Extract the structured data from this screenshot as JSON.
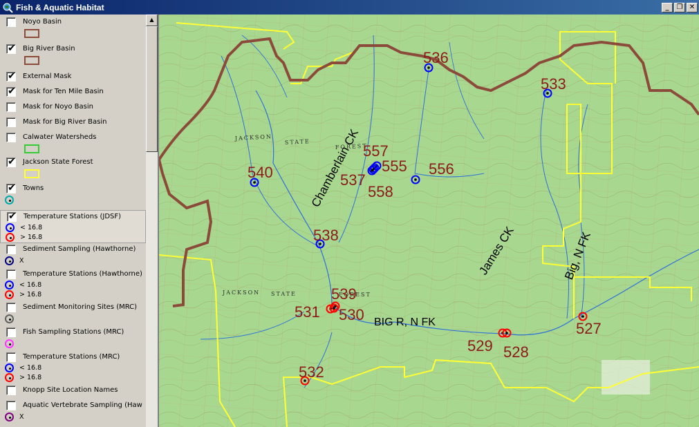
{
  "window": {
    "title": "Fish & Aquatic Habitat",
    "min_glyph": "_",
    "restore_glyph": "❐",
    "close_glyph": "✕"
  },
  "colors": {
    "title_bg": "#0a246a",
    "map_bg": "#a8d890",
    "basin_brown": "#8b4a3a",
    "jsf_yellow": "#ffff33",
    "station_blue": "#0000ff",
    "station_red": "#ff0000",
    "label_red": "#8b1a1a"
  },
  "toc": {
    "layers": [
      {
        "name": "Noyo Basin",
        "checked": false,
        "symbol": "brown-rect"
      },
      {
        "name": "Big River Basin",
        "checked": true,
        "symbol": "brown-rect"
      },
      {
        "name": "External Mask",
        "checked": true,
        "symbol": "none"
      },
      {
        "name": "Mask for Ten Mile Basin",
        "checked": true,
        "symbol": "none"
      },
      {
        "name": "Mask for Noyo Basin",
        "checked": false,
        "symbol": "none"
      },
      {
        "name": "Mask for Big River Basin",
        "checked": false,
        "symbol": "none"
      },
      {
        "name": "Calwater Watersheds",
        "checked": false,
        "symbol": "green-rect"
      },
      {
        "name": "Jackson State Forest",
        "checked": true,
        "symbol": "yellow-rect"
      },
      {
        "name": "Towns",
        "checked": true,
        "symbol": "teal-circle"
      },
      {
        "name": "Temperature Stations (JDSF)",
        "checked": true,
        "symbol": "blue-red",
        "selected": true
      },
      {
        "name": "Sediment Sampling (Hawthorne)",
        "checked": false,
        "symbol": "navy-x"
      },
      {
        "name": "Temperature Stations (Hawthorne)",
        "checked": false,
        "symbol": "blue-red"
      },
      {
        "name": "Sediment Monitoring Sites (MRC)",
        "checked": false,
        "symbol": "gray-circle"
      },
      {
        "name": "Fish Sampling Stations (MRC)",
        "checked": false,
        "symbol": "magenta-circle"
      },
      {
        "name": "Temperature Stations (MRC)",
        "checked": false,
        "symbol": "blue-red"
      },
      {
        "name": "Knopp Site Location Names",
        "checked": false,
        "symbol": "none"
      },
      {
        "name": "Aquatic Vertebrate Sampling (Haw",
        "checked": false,
        "symbol": "purple-x"
      }
    ],
    "legend_low": "< 16.8",
    "legend_high": "> 16.8",
    "legend_x": "X"
  },
  "map": {
    "stations": [
      {
        "id": "536",
        "color": "blue"
      },
      {
        "id": "533",
        "color": "blue"
      },
      {
        "id": "540",
        "color": "blue"
      },
      {
        "id": "557",
        "color": "blue"
      },
      {
        "id": "555",
        "color": "blue"
      },
      {
        "id": "556",
        "color": "blue"
      },
      {
        "id": "537",
        "color": "blue"
      },
      {
        "id": "558",
        "color": "blue"
      },
      {
        "id": "538",
        "color": "blue"
      },
      {
        "id": "539",
        "color": "red"
      },
      {
        "id": "531",
        "color": "red"
      },
      {
        "id": "530",
        "color": "red"
      },
      {
        "id": "529",
        "color": "red"
      },
      {
        "id": "528",
        "color": "red"
      },
      {
        "id": "527",
        "color": "red"
      },
      {
        "id": "532",
        "color": "red"
      }
    ],
    "streams": [
      "Chamberlain CK",
      "James CK",
      "Big, N FK",
      "BIG R, N FK"
    ],
    "topo_labels": [
      "JACKSON",
      "STATE",
      "FOREST",
      "JACKSON",
      "STATE",
      "FOREST"
    ]
  }
}
